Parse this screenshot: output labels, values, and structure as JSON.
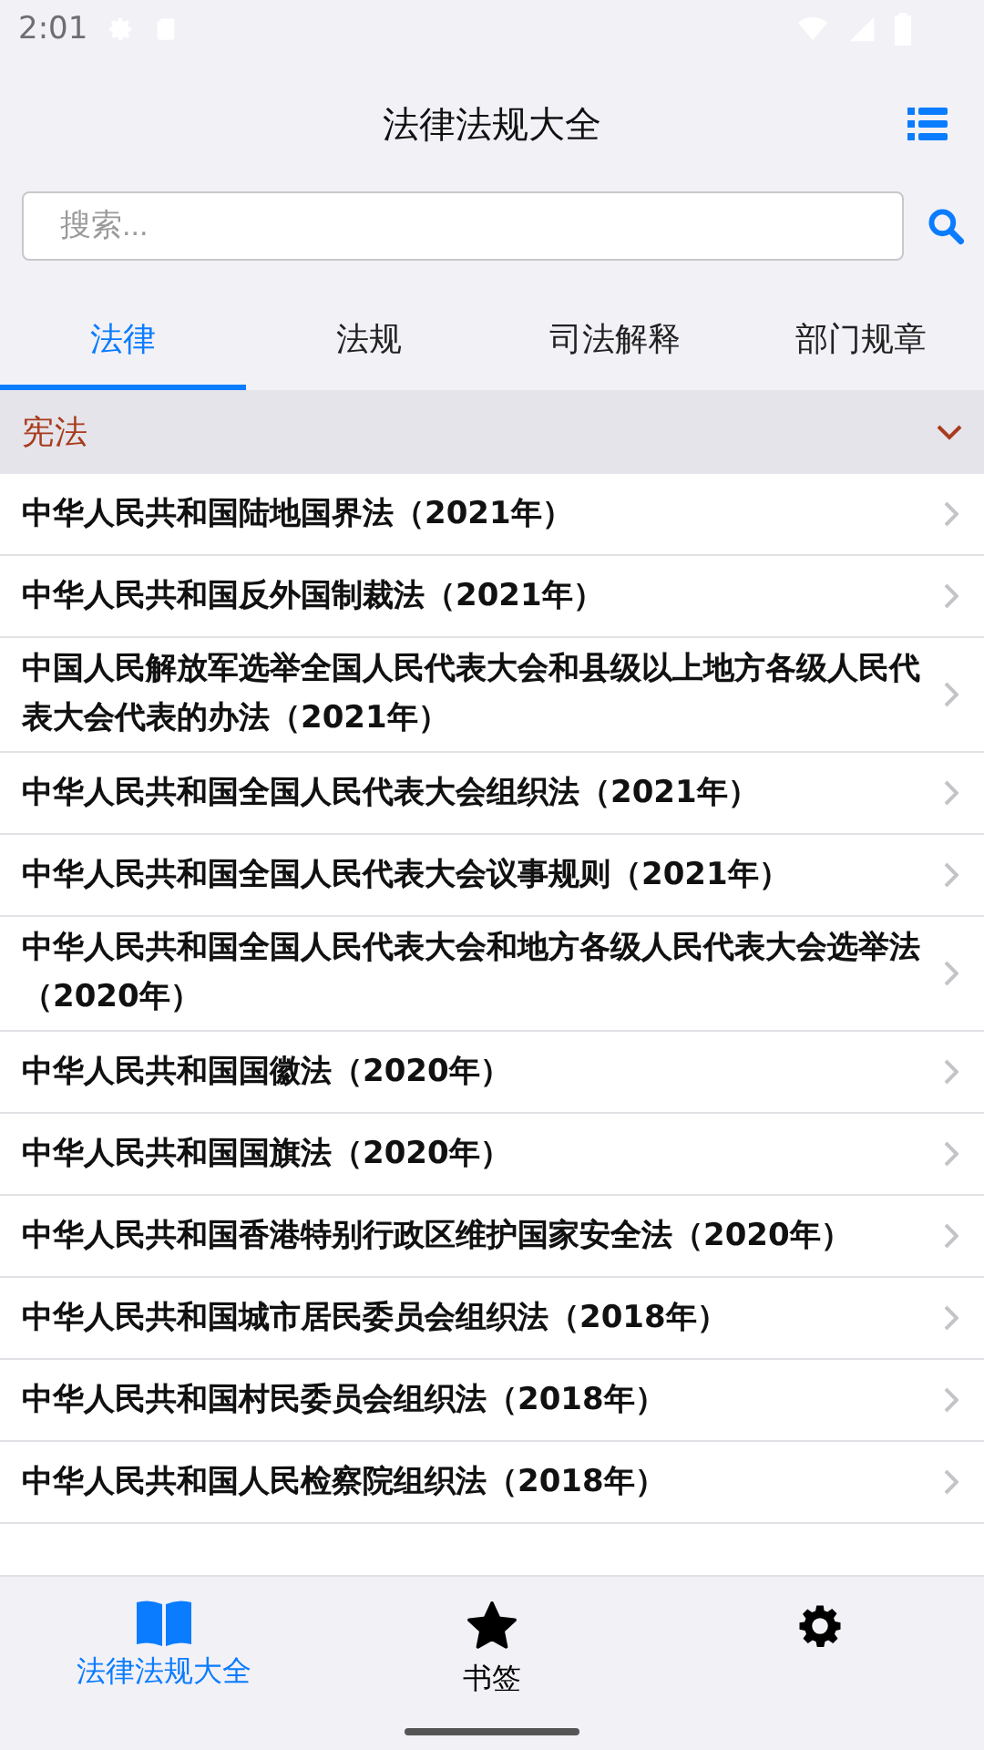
{
  "status_bar": {
    "time": "2:01"
  },
  "header": {
    "title": "法律法规大全"
  },
  "search": {
    "placeholder": "搜索..."
  },
  "tabs": [
    {
      "label": "法律",
      "selected": true
    },
    {
      "label": "法规",
      "selected": false
    },
    {
      "label": "司法解释",
      "selected": false
    },
    {
      "label": "部门规章",
      "selected": false
    }
  ],
  "section": {
    "title": "宪法",
    "expanded": true
  },
  "items": [
    {
      "title": "中华人民共和国陆地国界法（2021年）"
    },
    {
      "title": "中华人民共和国反外国制裁法（2021年）"
    },
    {
      "title": "中国人民解放军选举全国人民代表大会和县级以上地方各级人民代表大会代表的办法（2021年）"
    },
    {
      "title": "中华人民共和国全国人民代表大会组织法（2021年）"
    },
    {
      "title": "中华人民共和国全国人民代表大会议事规则（2021年）"
    },
    {
      "title": "中华人民共和国全国人民代表大会和地方各级人民代表大会选举法（2020年）"
    },
    {
      "title": "中华人民共和国国徽法（2020年）"
    },
    {
      "title": "中华人民共和国国旗法（2020年）"
    },
    {
      "title": "中华人民共和国香港特别行政区维护国家安全法（2020年）"
    },
    {
      "title": "中华人民共和国城市居民委员会组织法（2018年）"
    },
    {
      "title": "中华人民共和国村民委员会组织法（2018年）"
    },
    {
      "title": "中华人民共和国人民检察院组织法（2018年）"
    }
  ],
  "bottom_nav": [
    {
      "kind": "book",
      "label": "法律法规大全",
      "selected": true
    },
    {
      "kind": "star",
      "label": "书签",
      "selected": false
    },
    {
      "kind": "gear",
      "selected": false
    }
  ]
}
